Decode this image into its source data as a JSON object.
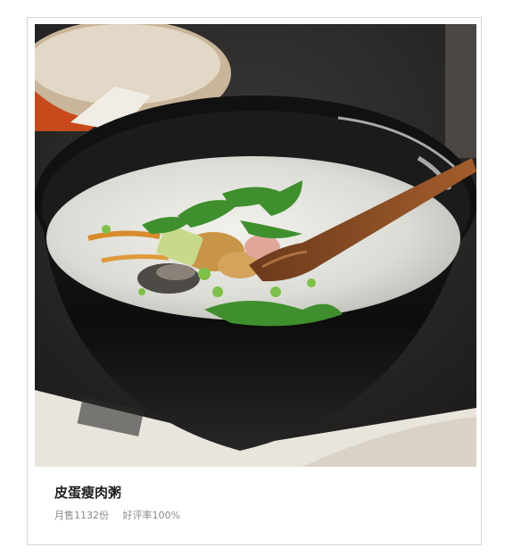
{
  "product": {
    "name": "皮蛋瘦肉粥",
    "monthly_sales": "月售1132份",
    "rating": "好评率100%"
  },
  "image": {
    "icon": "congee-bowl-photo"
  }
}
